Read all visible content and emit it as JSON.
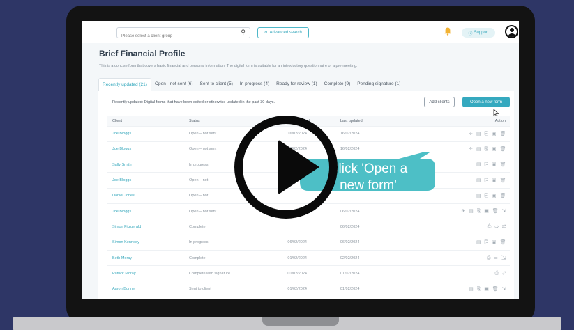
{
  "header": {
    "search_placeholder": "Please select a client group",
    "advanced_search": "Advanced search",
    "support": "Support"
  },
  "page": {
    "title": "Brief Financial Profile",
    "description": "This is a concise form that covers basic financial and personal information. The digital form is suitable for an introductory questionnaire or a pre-meeting."
  },
  "tabs": [
    {
      "label": "Recently updated (21)",
      "active": true
    },
    {
      "label": "Open - not sent (6)",
      "active": false
    },
    {
      "label": "Sent to client (5)",
      "active": false
    },
    {
      "label": "In progress (4)",
      "active": false
    },
    {
      "label": "Ready for review (1)",
      "active": false
    },
    {
      "label": "Complete (9)",
      "active": false
    },
    {
      "label": "Pending signature (1)",
      "active": false
    }
  ],
  "panel": {
    "note": "Recently updated: Digital forms that have been edited or otherwise updated in the past 30 days.",
    "add_clients": "Add clients",
    "open_new_form": "Open a new form"
  },
  "table": {
    "columns": [
      "Client",
      "Status",
      "Date created",
      "Last updated",
      "Action"
    ],
    "rows": [
      {
        "client": "Joe Bloggs",
        "status": "Open – not sent",
        "created": "16/02/2024",
        "updated": "16/02/2024",
        "actions": "✈ ▤ ⎘ ▣ 🗑"
      },
      {
        "client": "Joe Bloggs",
        "status": "Open – not sent",
        "created": "16/02/2024",
        "updated": "16/02/2024",
        "actions": "✈ ▤ ⎘ ▣ 🗑"
      },
      {
        "client": "Sally Smith",
        "status": "In progress",
        "created": "",
        "updated": "",
        "actions": "▤ ⎘ ▣ 🗑"
      },
      {
        "client": "Joe Bloggs",
        "status": "Open – not",
        "created": "",
        "updated": "",
        "actions": "▤ ⎘ ▣ 🗑"
      },
      {
        "client": "Daniel Jones",
        "status": "Open – not",
        "created": "",
        "updated": "",
        "actions": "▤ ⎘ ▣ 🗑"
      },
      {
        "client": "Joe Bloggs",
        "status": "Open – not sent",
        "created": "06/02/2024",
        "updated": "06/02/2024",
        "actions": "✈ ▤ ⎘ ▣ 🗑 ⇲"
      },
      {
        "client": "Simon Fitzgerald",
        "status": "Complete",
        "created": "",
        "updated": "06/02/2024",
        "actions": "⎙ ⇨ ⇄"
      },
      {
        "client": "Simon Kennedy",
        "status": "In progress",
        "created": "06/02/2024",
        "updated": "06/02/2024",
        "actions": "▤ ⎘ ▣ 🗑"
      },
      {
        "client": "Beth Moray",
        "status": "Complete",
        "created": "01/02/2024",
        "updated": "02/02/2024",
        "actions": "⎙ ⇨ ⇲"
      },
      {
        "client": "Patrick Moray",
        "status": "Complete with signature",
        "created": "01/02/2024",
        "updated": "01/02/2024",
        "actions": "⎙ ⇄"
      },
      {
        "client": "Aaron Bonner",
        "status": "Sent to client",
        "created": "01/02/2024",
        "updated": "01/02/2024",
        "actions": "▤ ⎘ ▣ 🗑 ⇲"
      }
    ]
  },
  "overlay": {
    "callout_line1": "Click 'Open a",
    "callout_line2": "new form'"
  },
  "colors": {
    "background": "#2e3666",
    "accent": "#35a9bf",
    "callout": "#4dbfc6"
  }
}
